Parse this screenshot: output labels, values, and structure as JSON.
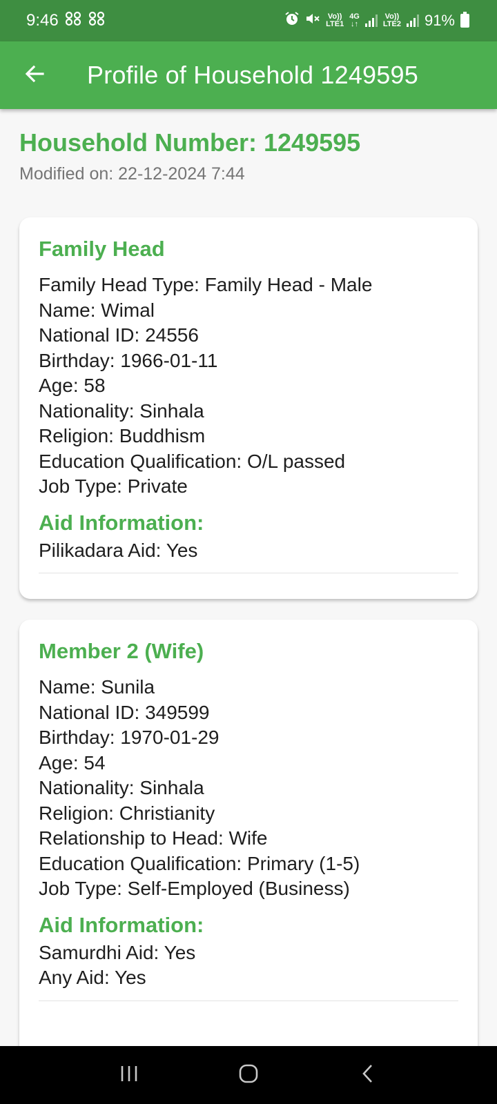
{
  "status_bar": {
    "time": "9:46",
    "left_icons": [
      "notification-icon",
      "notification-icon"
    ],
    "sim1_top": "Vo))",
    "sim1_bottom": "LTE1",
    "net_type": "4G",
    "sim2_top": "Vo))",
    "sim2_bottom": "LTE2",
    "battery": "91%"
  },
  "app_bar": {
    "title": "Profile of Household 1249595",
    "back_icon": "arrow-left-icon"
  },
  "household": {
    "number_label": "Household Number: 1249595",
    "modified": "Modified on: 22-12-2024 7:44"
  },
  "cards": [
    {
      "title": "Family Head",
      "fields": [
        "Family Head Type: Family Head - Male",
        "Name: Wimal",
        "National ID: 24556",
        "Birthday: 1966-01-11",
        "Age: 58",
        "Nationality: Sinhala",
        "Religion: Buddhism",
        "Education Qualification: O/L passed",
        "Job Type: Private"
      ],
      "aid_title": "Aid Information:",
      "aid": [
        "Pilikadara Aid: Yes"
      ]
    },
    {
      "title": "Member 2 (Wife)",
      "fields": [
        "Name: Sunila",
        "National ID: 349599",
        "Birthday: 1970-01-29",
        "Age: 54",
        "Nationality: Sinhala",
        "Religion: Christianity",
        "Relationship to Head: Wife",
        "Education Qualification: Primary (1-5)",
        "Job Type: Self-Employed (Business)"
      ],
      "aid_title": "Aid Information:",
      "aid": [
        "Samurdhi Aid: Yes",
        "Any Aid: Yes"
      ]
    }
  ],
  "colors": {
    "status_bar": "#3e8e41",
    "app_bar": "#4caf50",
    "accent_text": "#4caf50",
    "background": "#f7f7f7"
  },
  "nav_bar": {
    "icons": [
      "recent-apps-icon",
      "home-icon",
      "back-icon"
    ]
  }
}
